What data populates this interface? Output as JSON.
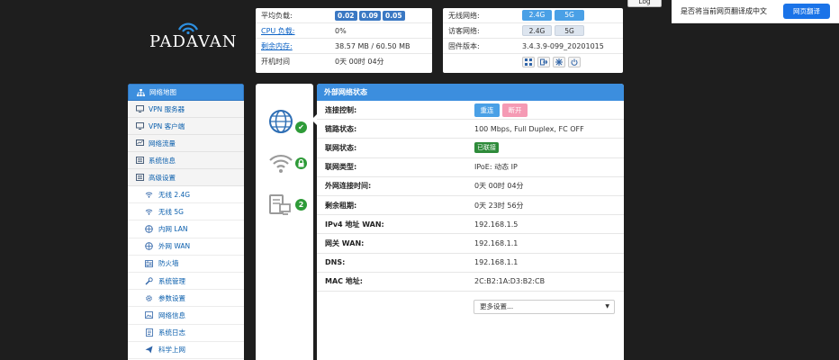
{
  "logo": {
    "text": "PADAVAN"
  },
  "system": {
    "load_label": "平均负载:",
    "load_values": [
      "0.02",
      "0.09",
      "0.05"
    ],
    "cpu_label": "CPU 负载:",
    "cpu_value": "0%",
    "mem_label": "剩余内存:",
    "mem_value": "38.57 MB / 60.50 MB",
    "uptime_label": "开机时间",
    "uptime_value": "0天 00时 04分"
  },
  "network": {
    "wireless_label": "无线网络:",
    "guest_label": "访客网络:",
    "band_24": "2.4G",
    "band_5": "5G",
    "firmware_label": "固件版本:",
    "firmware_value": "3.4.3.9-099_20201015"
  },
  "log_button": "Log",
  "translate": {
    "prompt": "是否将当前网页翻译成中文",
    "button": "网页翻译"
  },
  "sidebar": {
    "items": [
      {
        "label": "网络地图",
        "icon": "sitemap-icon",
        "active": true
      },
      {
        "label": "VPN 服务器",
        "icon": "monitor-icon"
      },
      {
        "label": "VPN 客户端",
        "icon": "monitor-icon"
      },
      {
        "label": "网络流量",
        "icon": "chart-icon"
      },
      {
        "label": "系统信息",
        "icon": "list-icon"
      },
      {
        "label": "高级设置",
        "icon": "list-icon"
      }
    ],
    "sub_items": [
      {
        "label": "无线 2.4G",
        "icon": "wifi-icon"
      },
      {
        "label": "无线 5G",
        "icon": "wifi-icon"
      },
      {
        "label": "内网 LAN",
        "icon": "globe-icon"
      },
      {
        "label": "外网 WAN",
        "icon": "globe-icon"
      },
      {
        "label": "防火墙",
        "icon": "firewall-icon"
      },
      {
        "label": "系统管理",
        "icon": "wrench-icon"
      },
      {
        "label": "参数设置",
        "icon": "gear-icon"
      },
      {
        "label": "网络信息",
        "icon": "image-icon"
      },
      {
        "label": "系统日志",
        "icon": "doc-icon"
      },
      {
        "label": "科学上网",
        "icon": "send-icon"
      }
    ]
  },
  "status_icons": {
    "wan_badge": "✔",
    "wifi_badge": "lock",
    "clients_badge": "2"
  },
  "wan": {
    "title": "外部网络状态",
    "rows": [
      {
        "label": "连接控制:",
        "type": "buttons",
        "connect": "重连",
        "disconnect": "断开"
      },
      {
        "label": "链路状态:",
        "value": "100 Mbps, Full Duplex, FC OFF"
      },
      {
        "label": "联网状态:",
        "type": "badge",
        "value": "已联接"
      },
      {
        "label": "联网类型:",
        "value": "IPoE: 动态 IP"
      },
      {
        "label": "外网连接时间:",
        "value": "0天 00时 04分"
      },
      {
        "label": "剩余租期:",
        "value": "0天 23时 56分"
      },
      {
        "label": "IPv4 地址 WAN:",
        "value": "192.168.1.5"
      },
      {
        "label": "网关 WAN:",
        "value": "192.168.1.1"
      },
      {
        "label": "DNS:",
        "value": "192.168.1.1"
      },
      {
        "label": "MAC 地址:",
        "value": "2C:B2:1A:D3:B2:CB"
      }
    ],
    "more_select": "更多设置..."
  }
}
